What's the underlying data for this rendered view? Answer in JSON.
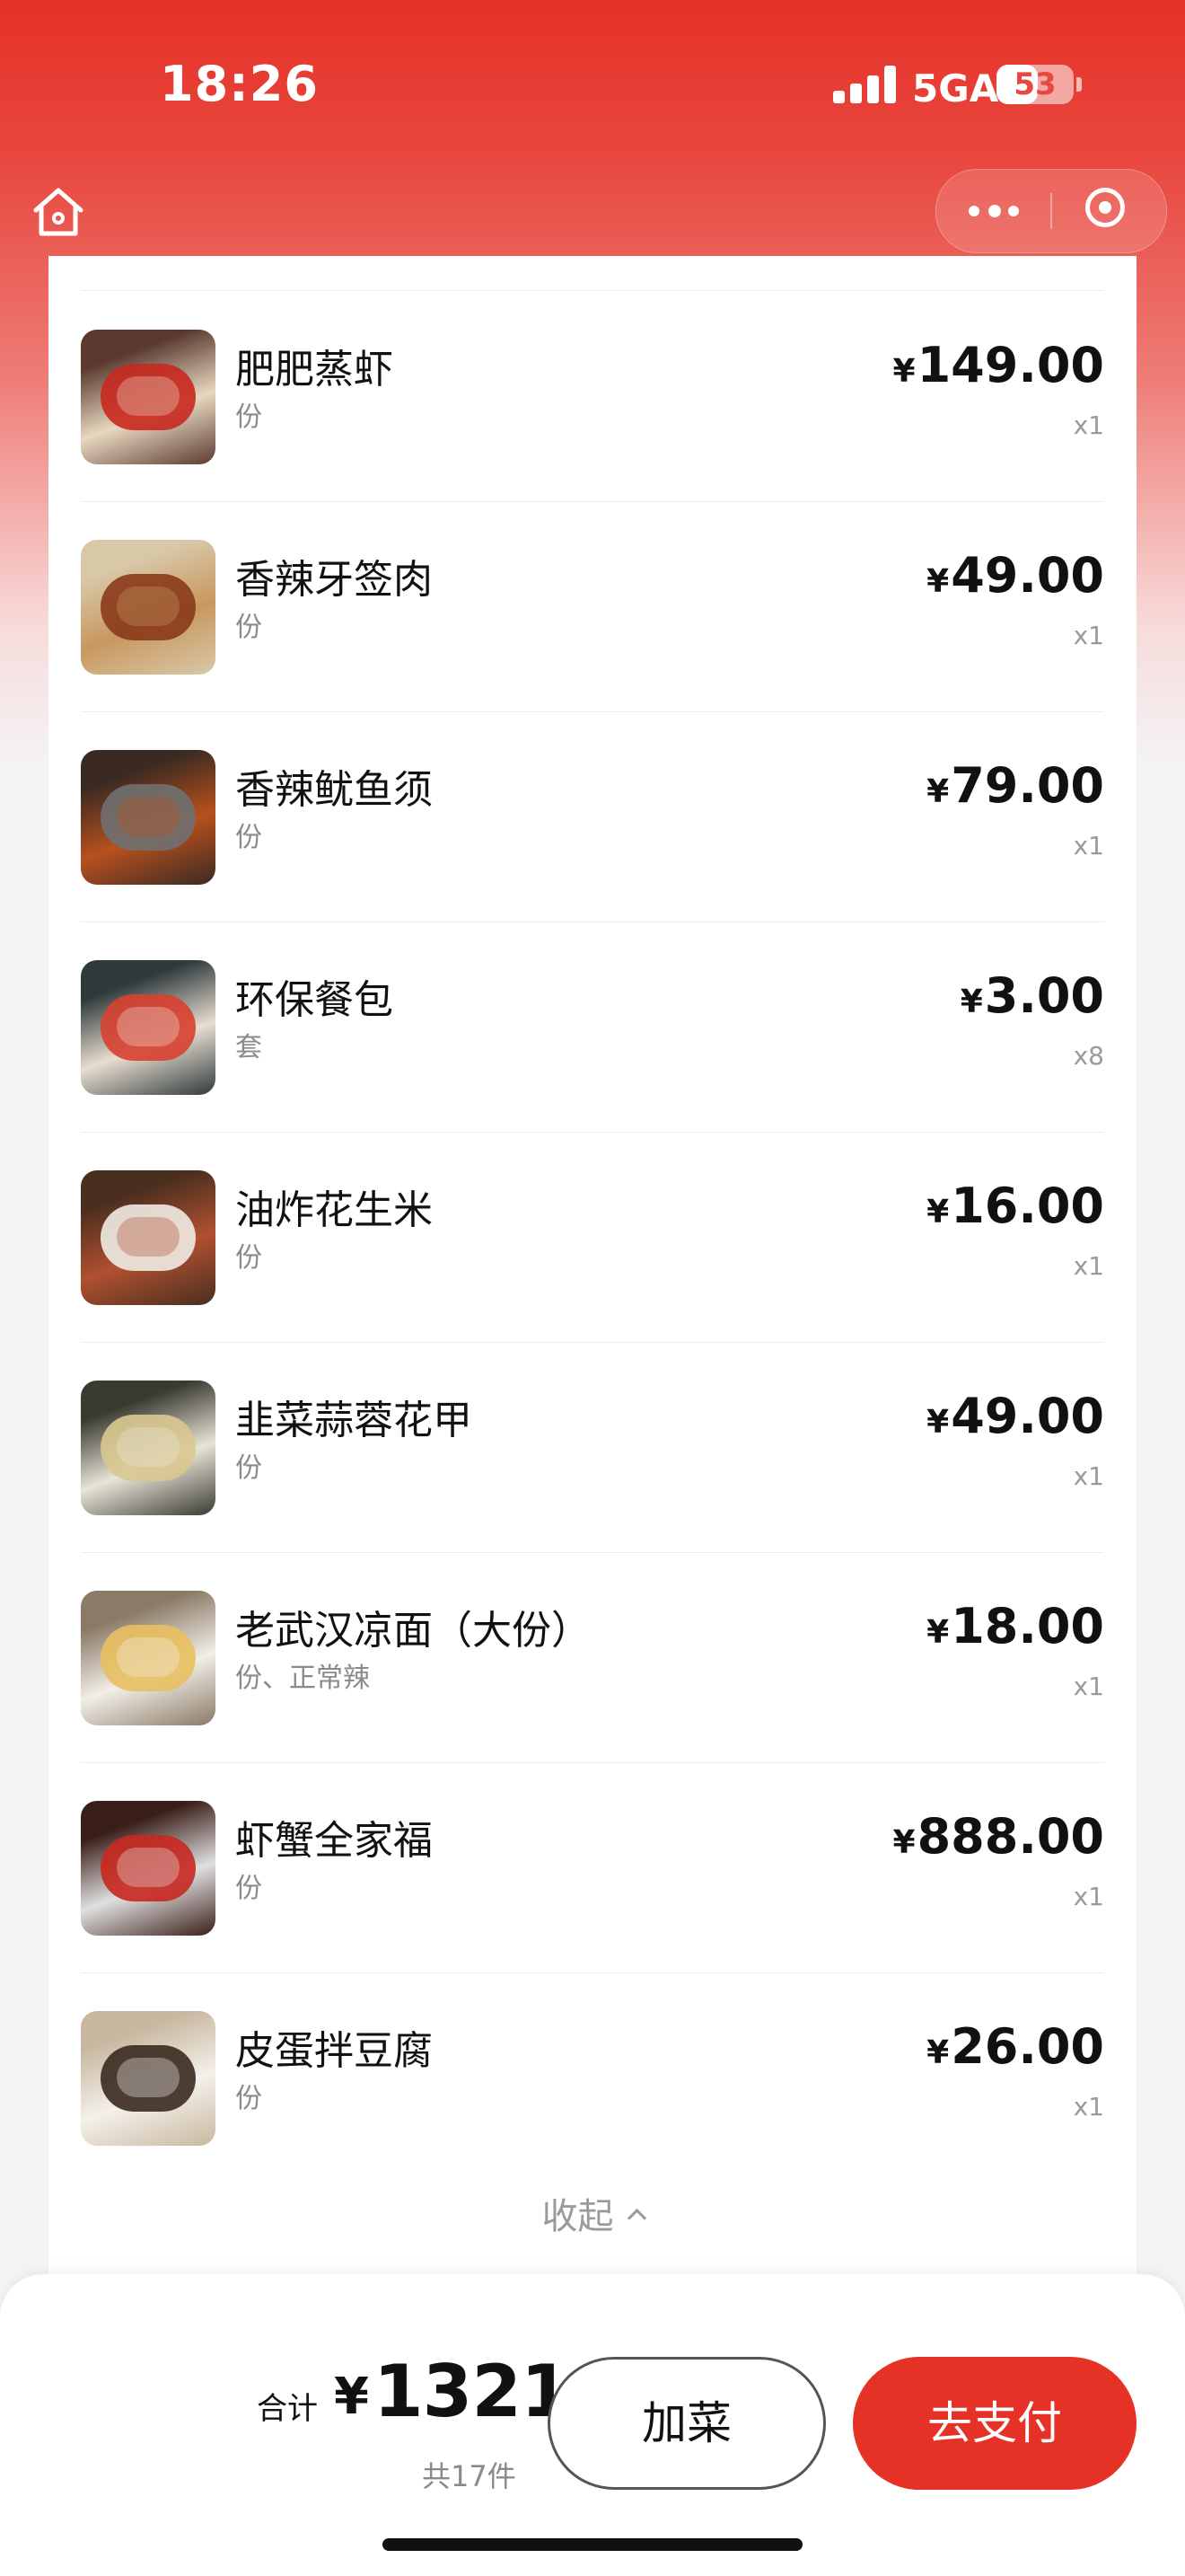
{
  "status_bar": {
    "time": "18:26",
    "network": "5GA",
    "battery_level": "53",
    "battery_fraction": 0.53
  },
  "nav": {
    "home_icon": "home-icon",
    "more_icon": "more-dots-icon",
    "close_icon": "target-circle-icon"
  },
  "items": [
    {
      "name": "肥肥蒸虾",
      "spec": "份",
      "currency": "¥",
      "price": "149.00",
      "qty": "x1",
      "thumb_colors": [
        "#5a3a30",
        "#c8281f",
        "#e8d8c0"
      ]
    },
    {
      "name": "香辣牙签肉",
      "spec": "份",
      "currency": "¥",
      "price": "49.00",
      "qty": "x1",
      "thumb_colors": [
        "#d8c8a8",
        "#8a3a1a",
        "#c89860"
      ]
    },
    {
      "name": "香辣鱿鱼须",
      "spec": "份",
      "currency": "¥",
      "price": "79.00",
      "qty": "x1",
      "thumb_colors": [
        "#3a2a22",
        "#707070",
        "#b8501e"
      ]
    },
    {
      "name": "环保餐包",
      "spec": "套",
      "currency": "¥",
      "price": "3.00",
      "qty": "x8",
      "thumb_colors": [
        "#2e3a3c",
        "#d84030",
        "#e8ddd0"
      ]
    },
    {
      "name": "油炸花生米",
      "spec": "份",
      "currency": "¥",
      "price": "16.00",
      "qty": "x1",
      "thumb_colors": [
        "#4a2e1e",
        "#f0ebe4",
        "#b05030"
      ]
    },
    {
      "name": "韭菜蒜蓉花甲",
      "spec": "份",
      "currency": "¥",
      "price": "49.00",
      "qty": "x1",
      "thumb_colors": [
        "#3a3a30",
        "#d8c890",
        "#e8e4d8"
      ]
    },
    {
      "name": "老武汉凉面（大份）",
      "spec": "份、正常辣",
      "currency": "¥",
      "price": "18.00",
      "qty": "x1",
      "thumb_colors": [
        "#8a7a66",
        "#e8c060",
        "#f2eee8"
      ]
    },
    {
      "name": "虾蟹全家福",
      "spec": "份",
      "currency": "¥",
      "price": "888.00",
      "qty": "x1",
      "thumb_colors": [
        "#3a1e18",
        "#c8281f",
        "#e0e0e0"
      ]
    },
    {
      "name": "皮蛋拌豆腐",
      "spec": "份",
      "currency": "¥",
      "price": "26.00",
      "qty": "x1",
      "thumb_colors": [
        "#c8b8a0",
        "#3a2a20",
        "#f4f0ea"
      ]
    }
  ],
  "collapse_label": "收起",
  "footer": {
    "total_label": "合计",
    "currency": "¥",
    "total_value": "1321",
    "count_label": "共17件",
    "add_label": "加菜",
    "pay_label": "去支付"
  }
}
